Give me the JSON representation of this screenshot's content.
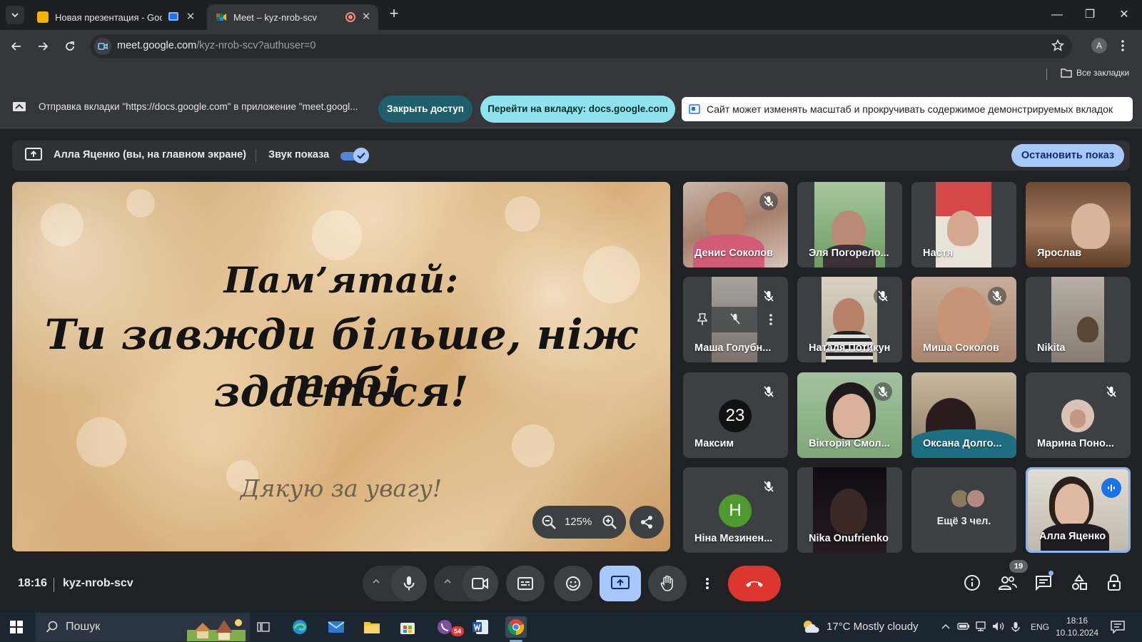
{
  "browser": {
    "tabs": [
      {
        "title": "Новая презентация - Goog",
        "active": false
      },
      {
        "title": "Meet – kyz-nrob-scv",
        "active": true
      }
    ],
    "url_host": "meet.google.com",
    "url_path": "/kyz-nrob-scv?authuser=0",
    "profile_initial": "A",
    "bookmarks_all": "Все закладки"
  },
  "infobar": {
    "message": "Отправка вкладки \"https://docs.google.com\" в приложение \"meet.googl...",
    "close_access": "Закрыть доступ",
    "go_to_tab": "Перейти на вкладку: docs.google.com",
    "zoom_notice": "Сайт может изменять масштаб и прокручивать содержимое демонстрируемых вкладок"
  },
  "meet": {
    "presenter_label": "Алла Яценко (вы, на главном экране)",
    "share_audio_label": "Звук показа",
    "share_audio_on": true,
    "stop_sharing": "Остановить показ",
    "slide": {
      "line1": "Пам’ятай:",
      "line2": "Ти завжди більше, ніж тобі",
      "line3": "здається!",
      "thanks": "Дякую за увагу!"
    },
    "zoom_level": "125%",
    "participants": [
      {
        "name": "Денис Соколов",
        "muted": true
      },
      {
        "name": "Эля Погорело...",
        "muted": false
      },
      {
        "name": "Настя",
        "muted": false
      },
      {
        "name": "Ярослав",
        "muted": false
      },
      {
        "name": "Маша Голубн...",
        "muted": true
      },
      {
        "name": "Наталя Потикун",
        "muted": true
      },
      {
        "name": "Миша Соколов",
        "muted": true
      },
      {
        "name": "Nikita",
        "muted": false
      },
      {
        "name": "Максим",
        "muted": true,
        "avatar_text": "23"
      },
      {
        "name": "Вікторія Смол...",
        "muted": true
      },
      {
        "name": "Оксана Долго...",
        "muted": false
      },
      {
        "name": "Марина Поно...",
        "muted": true
      },
      {
        "name": "Ніна Мезинен...",
        "muted": true,
        "avatar_text": "Н"
      },
      {
        "name": "Nika Onufrienko",
        "muted": false
      },
      {
        "name": "Алла Яценко",
        "muted": false,
        "speaking": true
      }
    ],
    "more_participants": "Ещё 3 чел.",
    "time": "18:16",
    "meeting_code": "kyz-nrob-scv",
    "people_count": "19",
    "colors": {
      "end_call": "#dc362e",
      "present_active": "#a8c7fa",
      "accent": "#8ab4f8"
    }
  },
  "taskbar": {
    "search_placeholder": "Пошук",
    "chat_badge": "54",
    "weather": "17°C  Mostly cloudy",
    "language": "ENG",
    "time": "18:16",
    "date": "10.10.2024"
  }
}
